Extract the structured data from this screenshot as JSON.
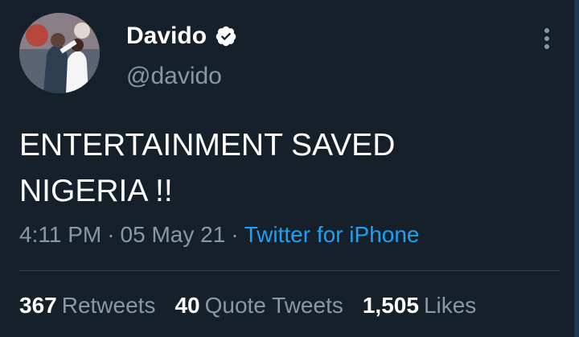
{
  "colors": {
    "background": "#15202b",
    "text_primary": "#ffffff",
    "text_secondary": "#8899a6",
    "link": "#1da1f2",
    "divider": "#38444d"
  },
  "author": {
    "display_name": "Davido",
    "handle": "@davido",
    "verified": true,
    "verified_icon": "verified-badge-icon",
    "avatar_icon": "avatar"
  },
  "menu_icon": "more-vertical-icon",
  "tweet": {
    "line1": "ENTERTAINMENT SAVED",
    "line2": "NIGERIA !!"
  },
  "meta": {
    "time": "4:11 PM",
    "separator": "·",
    "date": "05 May 21",
    "source": "Twitter for iPhone"
  },
  "stats": {
    "retweets_count": "367",
    "retweets_label": "Retweets",
    "quotes_count": "40",
    "quotes_label": "Quote Tweets",
    "likes_count": "1,505",
    "likes_label": "Likes"
  }
}
